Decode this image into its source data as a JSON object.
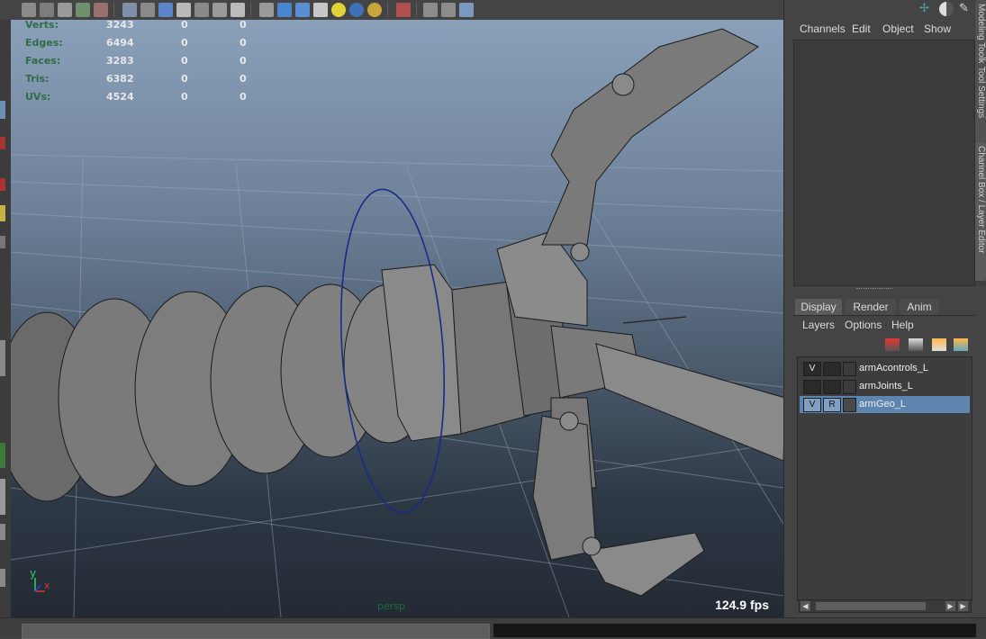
{
  "hud": {
    "stats": [
      {
        "label": "Verts:",
        "v1": "3243",
        "v2": "0",
        "v3": "0"
      },
      {
        "label": "Edges:",
        "v1": "6494",
        "v2": "0",
        "v3": "0"
      },
      {
        "label": "Faces:",
        "v1": "3283",
        "v2": "0",
        "v3": "0"
      },
      {
        "label": "Tris:",
        "v1": "6382",
        "v2": "0",
        "v3": "0"
      },
      {
        "label": "UVs:",
        "v1": "4524",
        "v2": "0",
        "v3": "0"
      }
    ],
    "fps": "124.9 fps",
    "camera": "persp",
    "axis_y": "y",
    "axis_x": "x"
  },
  "channel_box": {
    "menus": [
      "Channels",
      "Edit",
      "Object",
      "Show"
    ]
  },
  "side_tabs": [
    "Modeling Toolkit",
    "Tool Settings",
    "Channel Box / Layer Editor"
  ],
  "layer_editor": {
    "tabs": [
      "Display",
      "Render",
      "Anim"
    ],
    "active_tab": "Display",
    "menus": [
      "Layers",
      "Options",
      "Help"
    ],
    "layers": [
      {
        "visible": "V",
        "ref": "",
        "name": "armAcontrols_L",
        "selected": false
      },
      {
        "visible": "",
        "ref": "",
        "name": "armJoints_L",
        "selected": false
      },
      {
        "visible": "V",
        "ref": "R",
        "name": "armGeo_L",
        "selected": true
      }
    ]
  },
  "colors": {
    "selected_row": "#5d85b0",
    "hud_label": "#2f6d45",
    "ring": "#1a2a8a"
  }
}
